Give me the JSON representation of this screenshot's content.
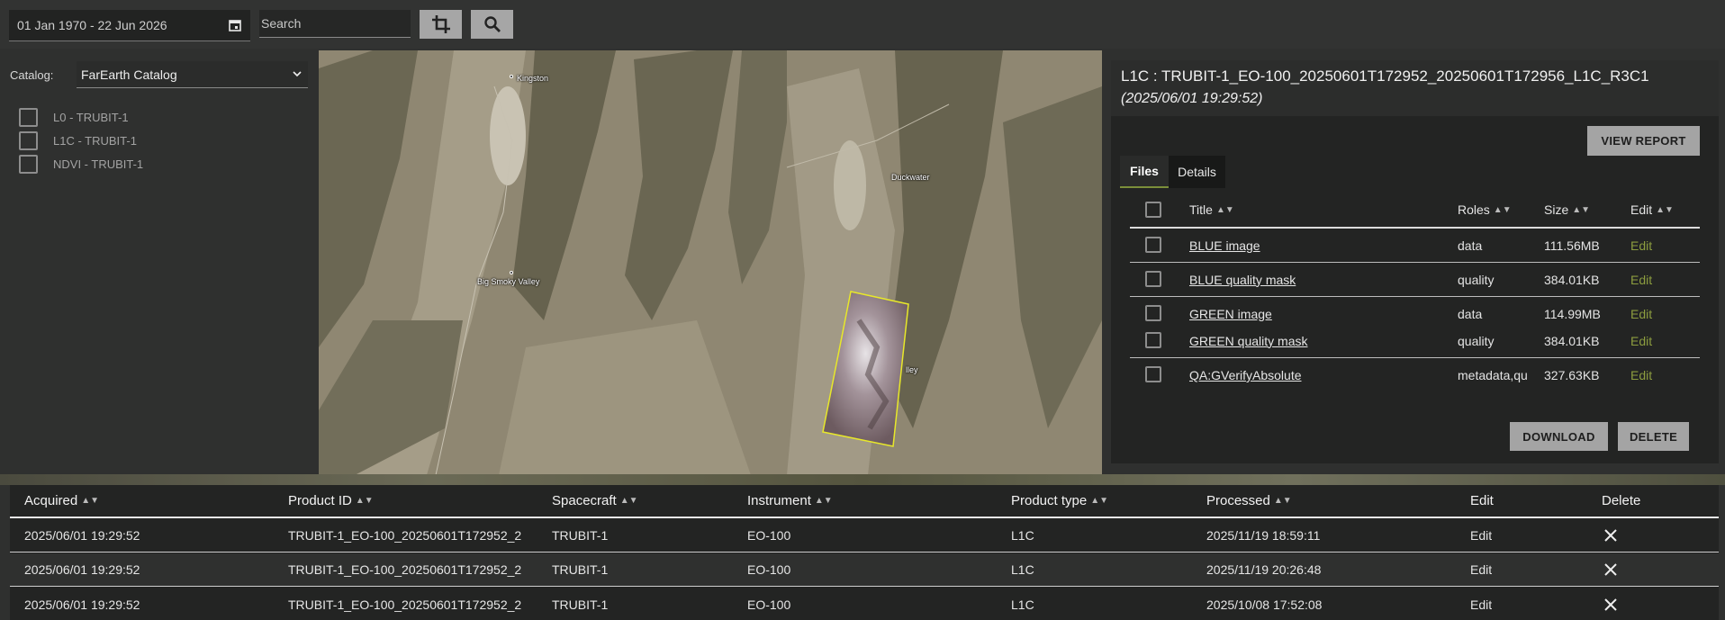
{
  "toolbar": {
    "date_range": "01 Jan 1970 - 22 Jun 2026",
    "search_placeholder": "Search",
    "crop_icon": "crop-icon",
    "search_icon": "search-icon",
    "calendar_icon": "calendar-icon"
  },
  "catalog": {
    "label": "Catalog:",
    "selected": "FarEarth Catalog",
    "layers": [
      {
        "label": "L0 - TRUBIT-1"
      },
      {
        "label": "L1C - TRUBIT-1"
      },
      {
        "label": "NDVI - TRUBIT-1"
      }
    ]
  },
  "map": {
    "labels": [
      "Kingston",
      "Big Smoky Valley",
      "Duckwater",
      "lley"
    ]
  },
  "detail": {
    "title": "L1C : TRUBIT-1_EO-100_20250601T172952_20250601T172956_L1C_R3C1",
    "date": "(2025/06/01 19:29:52)",
    "view_report": "VIEW REPORT",
    "tabs": [
      "Files",
      "Details"
    ],
    "columns": [
      "Title",
      "Roles",
      "Size",
      "Edit"
    ],
    "files": [
      {
        "title": "BLUE image",
        "role": "data",
        "size": "111.56MB",
        "edit": "Edit"
      },
      {
        "title": "BLUE quality mask",
        "role": "quality",
        "size": "384.01KB",
        "edit": "Edit"
      },
      {
        "title": "GREEN image",
        "role": "data",
        "size": "114.99MB",
        "edit": "Edit"
      },
      {
        "title": "GREEN quality mask",
        "role": "quality",
        "size": "384.01KB",
        "edit": "Edit"
      },
      {
        "title": "QA:GVerifyAbsolute",
        "role": "metadata,qu",
        "size": "327.63KB",
        "edit": "Edit"
      }
    ],
    "download": "DOWNLOAD",
    "delete": "DELETE"
  },
  "products": {
    "columns": [
      "Acquired",
      "Product ID",
      "Spacecraft",
      "Instrument",
      "Product type",
      "Processed",
      "Edit",
      "Delete"
    ],
    "rows": [
      {
        "acquired": "2025/06/01 19:29:52",
        "product_id": "TRUBIT-1_EO-100_20250601T172952_2",
        "spacecraft": "TRUBIT-1",
        "instrument": "EO-100",
        "type": "L1C",
        "processed": "2025/11/19 18:59:11",
        "edit": "Edit"
      },
      {
        "acquired": "2025/06/01 19:29:52",
        "product_id": "TRUBIT-1_EO-100_20250601T172952_2",
        "spacecraft": "TRUBIT-1",
        "instrument": "EO-100",
        "type": "L1C",
        "processed": "2025/11/19 20:26:48",
        "edit": "Edit"
      },
      {
        "acquired": "2025/06/01 19:29:52",
        "product_id": "TRUBIT-1_EO-100_20250601T172952_2",
        "spacecraft": "TRUBIT-1",
        "instrument": "EO-100",
        "type": "L1C",
        "processed": "2025/10/08 17:52:08",
        "edit": "Edit"
      }
    ]
  },
  "colors": {
    "accent_edit": "#8c9d3f",
    "button_grey": "#a4a4a4",
    "panel_bg": "#232423",
    "page_bg": "#2f302f",
    "footprint": "#e8e82a"
  }
}
